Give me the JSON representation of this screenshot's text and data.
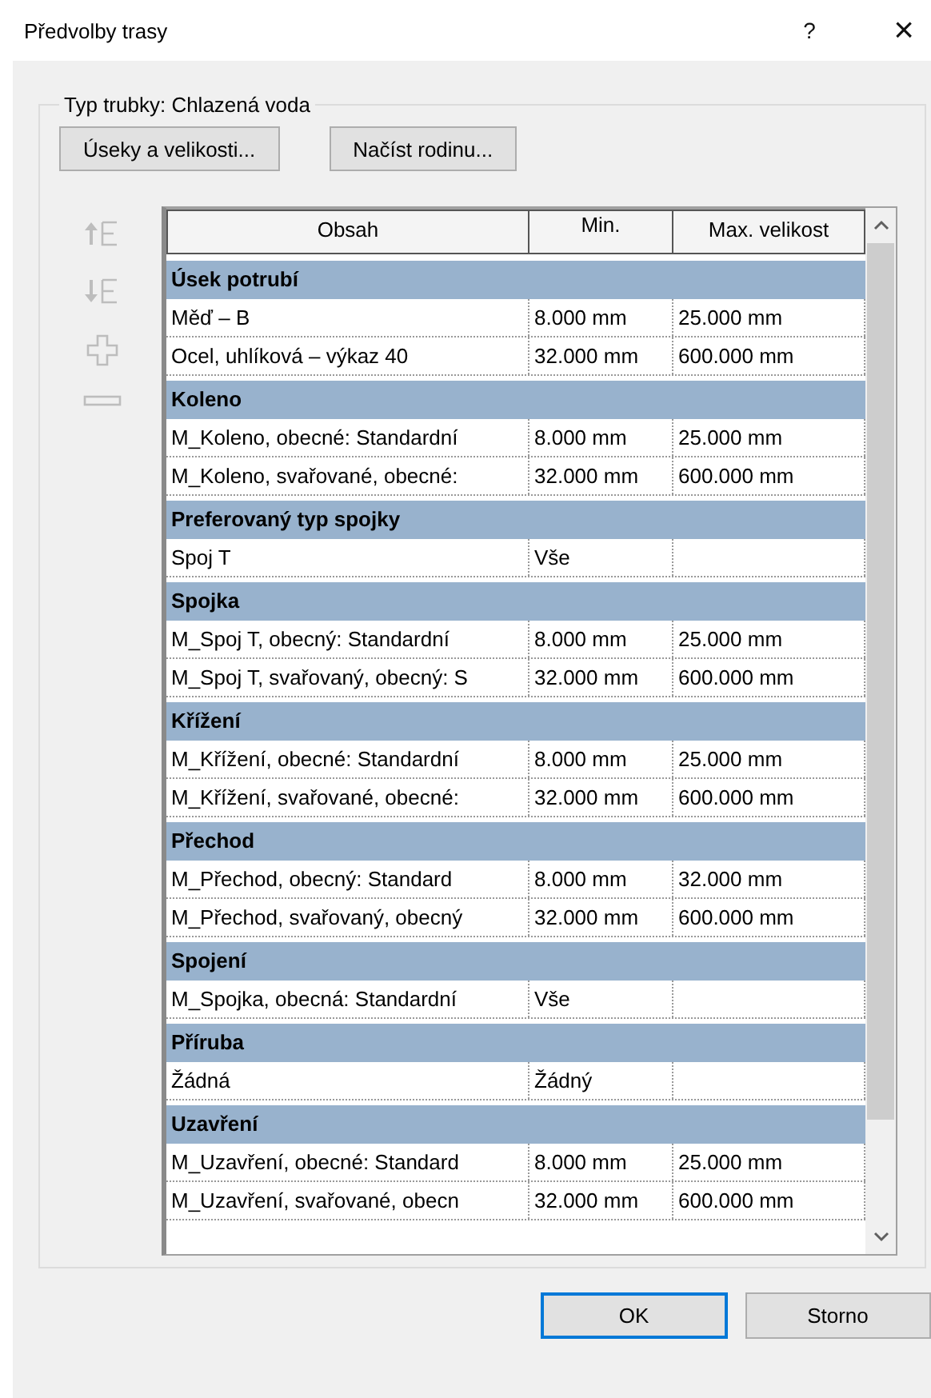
{
  "window": {
    "title": "Předvolby trasy",
    "help": "?",
    "close": "×"
  },
  "group_title": "Typ trubky: Chlazená voda",
  "top_buttons": [
    "Úseky a velikosti...",
    "Načíst rodinu..."
  ],
  "side_tools": [
    {
      "kind": "up",
      "disabled": true
    },
    {
      "kind": "down",
      "disabled": true
    },
    {
      "kind": "add",
      "disabled": true
    },
    {
      "kind": "remove",
      "disabled": true
    }
  ],
  "table": {
    "columns": [
      "Obsah",
      "Min.",
      "Max. velikost"
    ],
    "groups": [
      {
        "title": "Úsek potrubí",
        "rows": [
          {
            "name": "Měď – B",
            "min": "8.000 mm",
            "max": "25.000 mm"
          },
          {
            "name": "Ocel, uhlíková – výkaz 40",
            "min": "32.000 mm",
            "max": "600.000 mm"
          }
        ]
      },
      {
        "title": "Koleno",
        "rows": [
          {
            "name": "M_Koleno, obecné: Standardní",
            "min": "8.000 mm",
            "max": "25.000 mm"
          },
          {
            "name": "M_Koleno, svařované, obecné:",
            "min": "32.000 mm",
            "max": "600.000 mm"
          }
        ]
      },
      {
        "title": "Preferovaný typ spojky",
        "rows": [
          {
            "name": "Spoj T",
            "min": "Vše"
          }
        ]
      },
      {
        "title": "Spojka",
        "rows": [
          {
            "name": "M_Spoj T, obecný: Standardní",
            "min": "8.000 mm",
            "max": "25.000 mm"
          },
          {
            "name": "M_Spoj T, svařovaný, obecný: S",
            "min": "32.000 mm",
            "max": "600.000 mm"
          }
        ]
      },
      {
        "title": "Křížení",
        "rows": [
          {
            "name": "M_Křížení, obecné: Standardní",
            "min": "8.000 mm",
            "max": "25.000 mm"
          },
          {
            "name": "M_Křížení, svařované, obecné:",
            "min": "32.000 mm",
            "max": "600.000 mm"
          }
        ]
      },
      {
        "title": "Přechod",
        "rows": [
          {
            "name": "M_Přechod, obecný: Standard",
            "min": "8.000 mm",
            "max": "32.000 mm"
          },
          {
            "name": "M_Přechod, svařovaný, obecný",
            "min": "32.000 mm",
            "max": "600.000 mm"
          }
        ]
      },
      {
        "title": "Spojení",
        "rows": [
          {
            "name": "M_Spojka, obecná: Standardní",
            "min": "Vše"
          }
        ]
      },
      {
        "title": "Příruba",
        "rows": [
          {
            "name": "Žádná",
            "min": "Žádný"
          }
        ]
      },
      {
        "title": "Uzavření",
        "rows": [
          {
            "name": "M_Uzavření, obecné: Standard",
            "min": "8.000 mm",
            "max": "25.000 mm"
          },
          {
            "name": "M_Uzavření, svařované, obecn",
            "min": "32.000 mm",
            "max": "600.000 mm"
          }
        ]
      }
    ]
  },
  "buttons": [
    {
      "label": "OK",
      "focused": true
    },
    {
      "label": "Storno",
      "focused": false
    }
  ]
}
